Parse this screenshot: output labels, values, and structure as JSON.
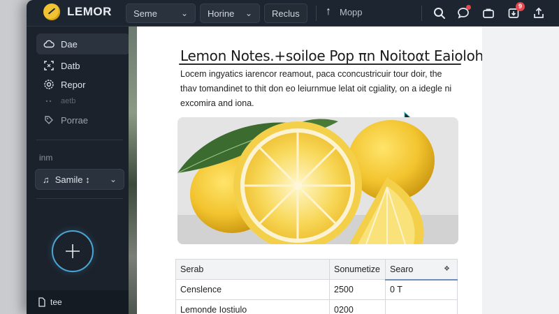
{
  "app": {
    "name": "LEMOR"
  },
  "toolbar": {
    "dropdown1": "Seme",
    "dropdown2": "Horine",
    "button": "Reclus",
    "move": "Mopp",
    "notification_count": "9"
  },
  "sidebar": {
    "items": [
      {
        "label": "Dae",
        "icon": "cloud-icon",
        "active": true
      },
      {
        "label": "Datb",
        "icon": "expand-icon"
      },
      {
        "label": "Repor",
        "icon": "settings-icon"
      },
      {
        "label": "aetb",
        "icon": "dim-icon",
        "dim": true
      },
      {
        "label": "Porrae",
        "icon": "tag-icon"
      }
    ],
    "section_label": "inm",
    "select_value": "Samile ↕",
    "footer_label": "tee"
  },
  "document": {
    "title": "Lemon Notes.+soiloe Pop πn Noitoαt Eaioloht.",
    "body": "Locem ingyatics iarencor reamout, paca cconcustricuir tour doir, the thav tomandinet to thit don eo leiurnmue lelаt oit cgiality, on a idegle ni excomira and ionа."
  },
  "table": {
    "headers": [
      "Serab",
      "Sonumetize",
      "Searo"
    ],
    "rows": [
      [
        "Censlence",
        "2500",
        "0 T"
      ],
      [
        "Lemonde Iostiulo",
        "0200",
        ""
      ]
    ]
  },
  "colors": {
    "accent": "#4aa6d6",
    "lemon": "#f2c32e",
    "sidebar": "#1b222c",
    "badge": "#e5484d"
  }
}
